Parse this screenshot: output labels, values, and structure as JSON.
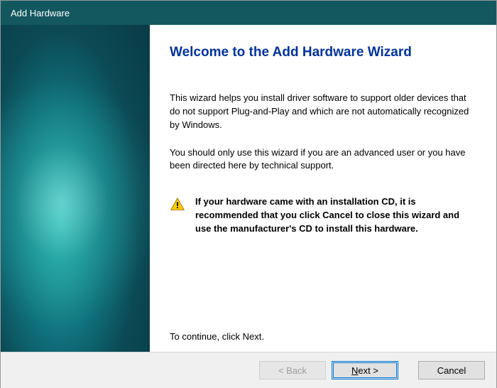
{
  "titlebar": {
    "title": "Add Hardware"
  },
  "content": {
    "heading": "Welcome to the Add Hardware Wizard",
    "para1": "This wizard helps you install driver software to support older devices that do not support Plug-and-Play and which are not automatically recognized by Windows.",
    "para2": "You should only use this wizard if you are an advanced user or you have been directed here by technical support.",
    "note": "If your hardware came with an installation CD, it is recommended that you click Cancel to close this wizard and use the manufacturer's CD to install this hardware.",
    "continue": "To continue, click Next."
  },
  "buttons": {
    "back": "< Back",
    "next_prefix": "N",
    "next_rest": "ext >",
    "cancel": "Cancel"
  }
}
